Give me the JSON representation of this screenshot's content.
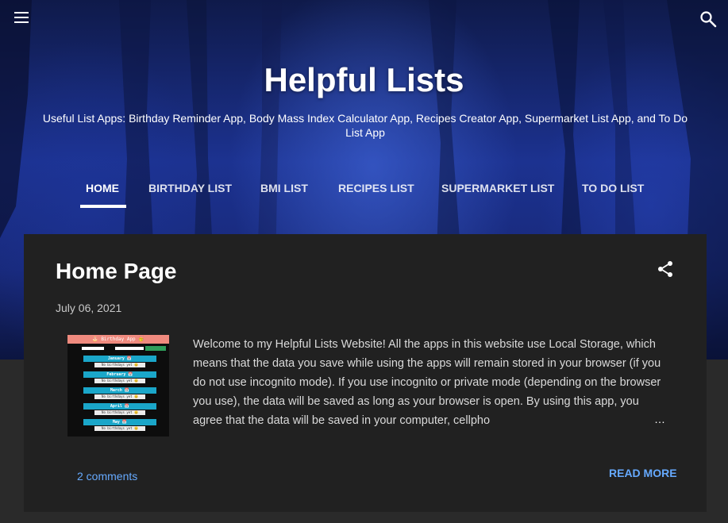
{
  "header": {
    "menu_icon": "hamburger-menu-icon",
    "search_icon": "search-icon",
    "title": "Helpful Lists",
    "description": "Useful List Apps: Birthday Reminder App, Body Mass Index Calculator App, Recipes Creator App, Supermarket List App, and To Do List App"
  },
  "nav": {
    "items": [
      {
        "label": "Home",
        "active": true
      },
      {
        "label": "Birthday List",
        "active": false
      },
      {
        "label": "BMI List",
        "active": false
      },
      {
        "label": "Recipes List",
        "active": false
      },
      {
        "label": "Supermarket List",
        "active": false
      },
      {
        "label": "To Do List",
        "active": false
      }
    ]
  },
  "post": {
    "title": "Home Page",
    "date": "July 06, 2021",
    "share_icon": "share-icon",
    "snippet": "Welcome to my Helpful Lists Website! All the apps in this website use Local Storage, which means that the data you save while using the apps will remain stored in your browser (if you do not use incognito mode). If you use incognito or private mode (depending on the browser you use), the data will be saved as long as your browser is open. By using this app, you agree that the data will be saved in your computer, cellpho",
    "ellipsis": "…",
    "comments": "2 comments",
    "read_more": "Read more",
    "thumbnail": {
      "header": "🎂 Birthday App 🥳",
      "months": [
        "January 📅",
        "February 📅",
        "March 📅",
        "April 📅",
        "May 📅"
      ],
      "note": "No birthdays yet 😊"
    }
  },
  "colors": {
    "accent": "#66aaff",
    "card": "#212121",
    "page": "#2a2a2a"
  }
}
